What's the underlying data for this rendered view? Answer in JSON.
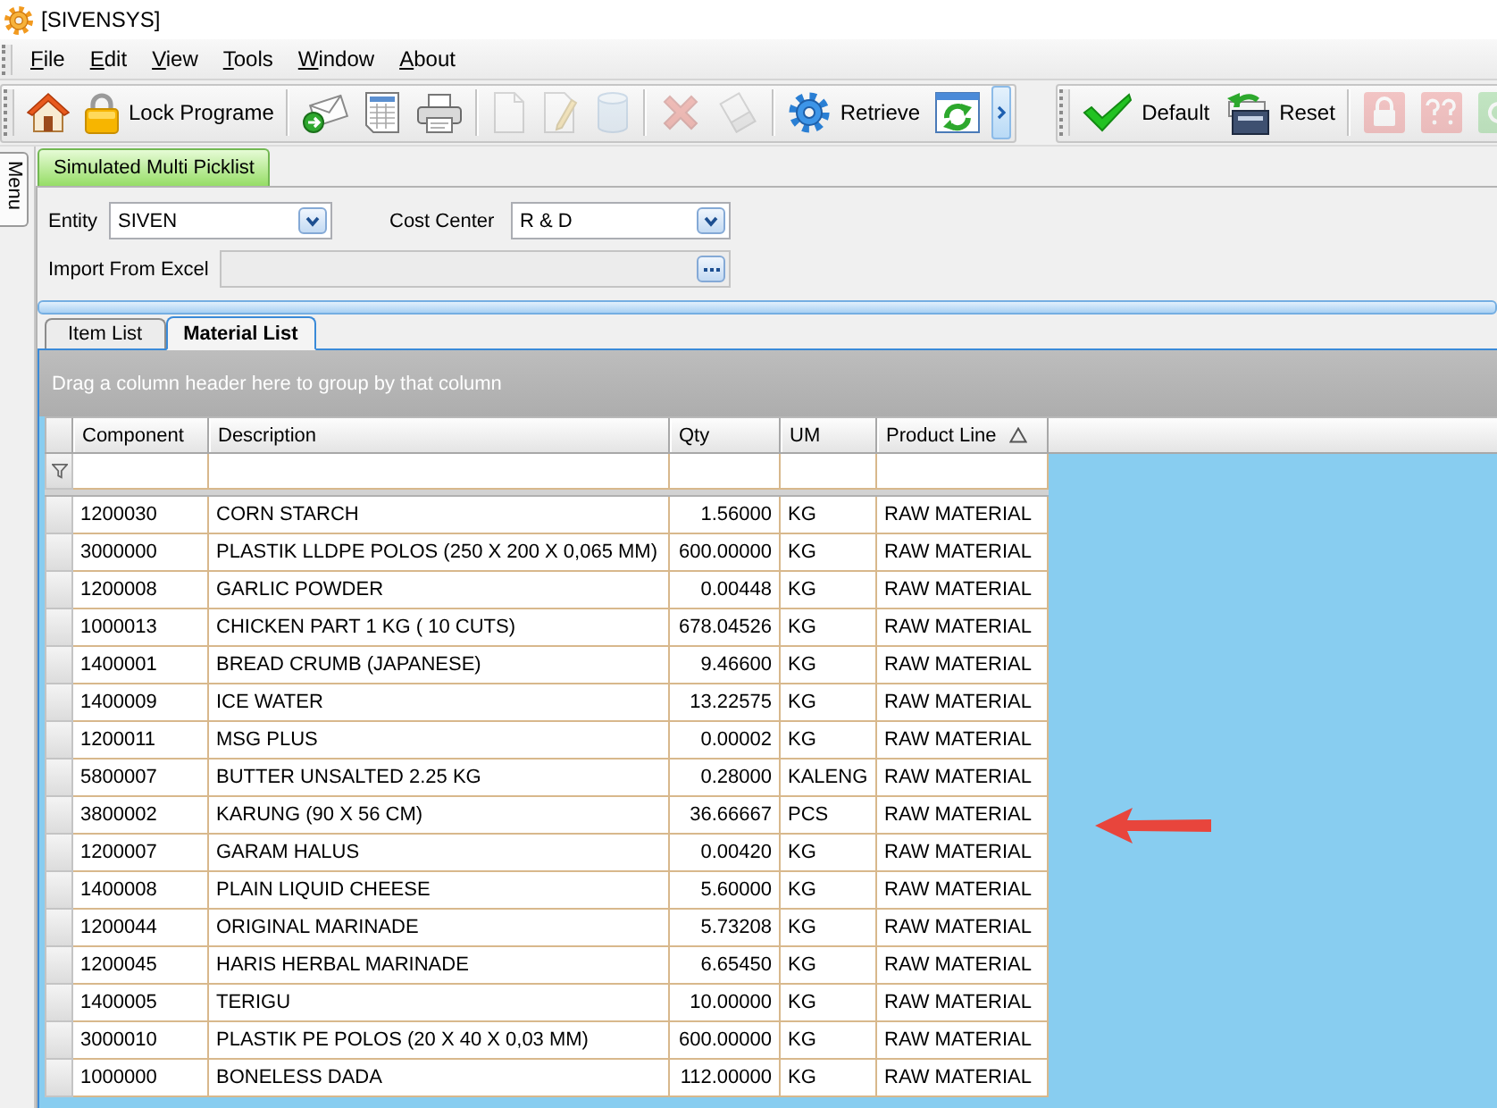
{
  "window": {
    "title": "[SIVENSYS]"
  },
  "menu": [
    "File",
    "Edit",
    "View",
    "Tools",
    "Window",
    "About"
  ],
  "main_toolbar": {
    "groups": [
      [
        {
          "disabled": false
        },
        {
          "label": "Lock Programe",
          "disabled": false
        }
      ],
      [
        {
          "disabled": false
        },
        {
          "disabled": false
        },
        {
          "disabled": false
        }
      ],
      [
        {
          "disabled": true
        },
        {
          "disabled": true
        },
        {
          "disabled": true
        }
      ],
      [
        {
          "disabled": true
        },
        {
          "disabled": true
        }
      ],
      [
        {
          "label": "Retrieve",
          "disabled": false
        },
        {
          "disabled": false
        }
      ]
    ]
  },
  "secondary_toolbar": {
    "groups": [
      [
        {
          "label": "Default",
          "disabled": false
        },
        {
          "label": "Reset",
          "disabled": false
        }
      ],
      [
        {
          "disabled": true
        },
        {
          "disabled": true
        },
        {
          "disabled": true
        }
      ]
    ]
  },
  "side_tab": {
    "label": "Menu"
  },
  "document_tabs": [
    {
      "label": "Simulated Multi Picklist",
      "selected": true
    }
  ],
  "form": {
    "entity": {
      "label": "Entity",
      "value": "SIVEN"
    },
    "cost_center": {
      "label": "Cost Center",
      "value": "R & D"
    },
    "import_from_excel": {
      "label": "Import From Excel",
      "disabled": true
    }
  },
  "sub_tabs": [
    {
      "label": "Item List",
      "selected": false
    },
    {
      "label": "Material List",
      "selected": true
    }
  ],
  "grid": {
    "group_hint": "Drag a column header here to group by that column",
    "columns": [
      {
        "label": "Component",
        "kind": "text",
        "sorted": false
      },
      {
        "label": "Description",
        "kind": "text",
        "sorted": false
      },
      {
        "label": "Qty",
        "kind": "number",
        "sorted": false
      },
      {
        "label": "UM",
        "kind": "text",
        "sorted": false
      },
      {
        "label": "Product Line",
        "kind": "text",
        "sorted": true
      }
    ],
    "rows": [
      {
        "cells": [
          "1200030",
          "CORN STARCH",
          "1.56000",
          "KG",
          "RAW MATERIAL"
        ]
      },
      {
        "cells": [
          "3000000",
          "PLASTIK LLDPE POLOS (250 X 200 X 0,065 MM)",
          "600.00000",
          "KG",
          "RAW MATERIAL"
        ]
      },
      {
        "cells": [
          "1200008",
          "GARLIC POWDER",
          "0.00448",
          "KG",
          "RAW MATERIAL"
        ]
      },
      {
        "cells": [
          "1000013",
          "CHICKEN PART 1 KG ( 10 CUTS)",
          "678.04526",
          "KG",
          "RAW MATERIAL"
        ]
      },
      {
        "cells": [
          "1400001",
          "BREAD CRUMB (JAPANESE)",
          "9.46600",
          "KG",
          "RAW MATERIAL"
        ]
      },
      {
        "cells": [
          "1400009",
          "ICE WATER",
          "13.22575",
          "KG",
          "RAW MATERIAL"
        ]
      },
      {
        "cells": [
          "1200011",
          "MSG PLUS",
          "0.00002",
          "KG",
          "RAW MATERIAL"
        ]
      },
      {
        "cells": [
          "5800007",
          "BUTTER UNSALTED 2.25 KG",
          "0.28000",
          "KALENG",
          "RAW MATERIAL"
        ]
      },
      {
        "cells": [
          "3800002",
          "KARUNG (90 X 56 CM)",
          "36.66667",
          "PCS",
          "RAW MATERIAL"
        ]
      },
      {
        "cells": [
          "1200007",
          "GARAM HALUS",
          "0.00420",
          "KG",
          "RAW MATERIAL"
        ]
      },
      {
        "cells": [
          "1400008",
          "PLAIN LIQUID CHEESE",
          "5.60000",
          "KG",
          "RAW MATERIAL"
        ]
      },
      {
        "cells": [
          "1200044",
          "ORIGINAL MARINADE",
          "5.73208",
          "KG",
          "RAW MATERIAL"
        ]
      },
      {
        "cells": [
          "1200045",
          "HARIS HERBAL MARINADE",
          "6.65450",
          "KG",
          "RAW MATERIAL"
        ]
      },
      {
        "cells": [
          "1400005",
          "TERIGU",
          "10.00000",
          "KG",
          "RAW MATERIAL"
        ]
      },
      {
        "cells": [
          "3000010",
          "PLASTIK PE POLOS (20 X 40 X 0,03 MM)",
          "600.00000",
          "KG",
          "RAW MATERIAL"
        ]
      },
      {
        "cells": [
          "1000000",
          "BONELESS DADA",
          "112.00000",
          "KG",
          "RAW MATERIAL"
        ]
      }
    ]
  }
}
